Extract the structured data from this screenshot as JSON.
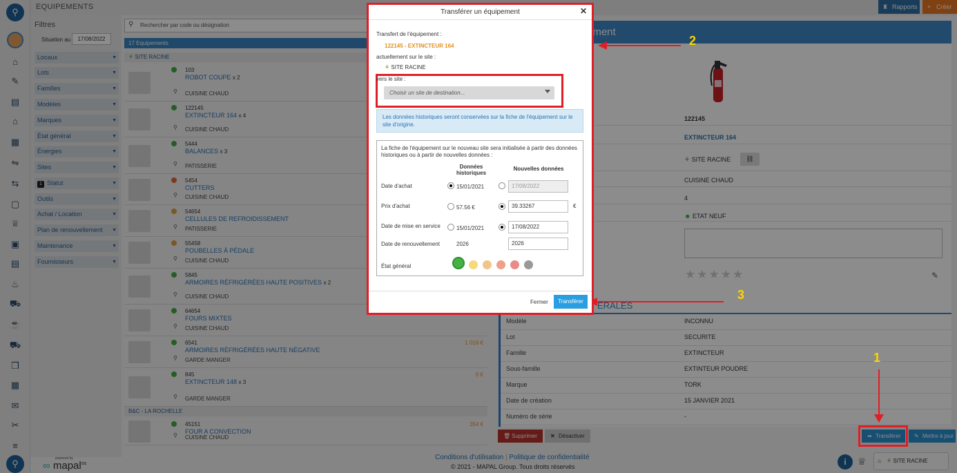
{
  "app": {
    "section_title": "EQUIPEMENTS",
    "reports_label": "Rapports",
    "create_label": "Créer"
  },
  "filters": {
    "title": "Filtres",
    "situation_label": "Situation au",
    "situation_date": "17/08/2022",
    "items": [
      "Locaux",
      "Lots",
      "Familles",
      "Modèles",
      "Marques",
      "État général",
      "Énergies",
      "Sites",
      "Statut",
      "Outils",
      "Achat / Location",
      "Plan de renouvellement",
      "Maintenance",
      "Fournisseurs"
    ],
    "status_badge": "1"
  },
  "list": {
    "search_placeholder": "Rechercher par code ou désignation",
    "count_label": "17 Equipements",
    "site1": "SITE RACINE",
    "site2": "B&C - LA ROCHELLE",
    "items": [
      {
        "code": "103",
        "name": "ROBOT COUPE",
        "qty": "x 2",
        "loc": "CUISINE CHAUD",
        "price": ""
      },
      {
        "code": "122145",
        "name": "EXTINCTEUR 164",
        "qty": "x 4",
        "loc": "CUISINE CHAUD",
        "price": ""
      },
      {
        "code": "5444",
        "name": "BALANCES",
        "qty": "x 3",
        "loc": "PATISSERIE",
        "price": ""
      },
      {
        "code": "5454",
        "name": "CUTTERS",
        "qty": "",
        "loc": "CUISINE CHAUD",
        "price": ""
      },
      {
        "code": "54654",
        "name": "CELLULES DE REFROIDISSEMENT",
        "qty": "",
        "loc": "PATISSERIE",
        "price": ""
      },
      {
        "code": "55458",
        "name": "POUBELLES À PÉDALE",
        "qty": "",
        "loc": "CUISINE CHAUD",
        "price": ""
      },
      {
        "code": "5845",
        "name": "ARMOIRES RÉFRIGÉRÉES HAUTE POSITIVES",
        "qty": "x 2",
        "loc": "CUISINE CHAUD",
        "price": ""
      },
      {
        "code": "64654",
        "name": "FOURS MIXTES",
        "qty": "",
        "loc": "CUISINE CHAUD",
        "price": ""
      },
      {
        "code": "6541",
        "name": "ARMOIRES RÉFRIGÉRÉES HAUTE NÉGATIVE",
        "qty": "",
        "loc": "GARDE MANGER",
        "price": "1 016 €"
      },
      {
        "code": "845",
        "name": "EXTINCTEUR 148",
        "qty": "x 3",
        "loc": "GARDE MANGER",
        "price": "0 €"
      },
      {
        "code": "45151",
        "name": "FOUR A CONVECTION",
        "qty": "",
        "loc": "CUISINE CHAUD",
        "price": "354 €"
      }
    ]
  },
  "detail": {
    "header": "ement",
    "code": "122145",
    "name": "EXTINCTEUR 164",
    "site": "SITE RACINE",
    "room": "CUISINE CHAUD",
    "qty": "4",
    "state": "ETAT NEUF",
    "section_title": "ÉRALES",
    "rows": [
      {
        "label": "Modèle",
        "value": "INCONNU"
      },
      {
        "label": "Lot",
        "value": "SECURITE"
      },
      {
        "label": "Famille",
        "value": "EXTINCTEUR"
      },
      {
        "label": "Sous-famille",
        "value": "EXTINTEUR POUDRE"
      },
      {
        "label": "Marque",
        "value": "TORK"
      },
      {
        "label": "Date de création",
        "value": "15 JANVIER 2021"
      },
      {
        "label": "Numéro de série",
        "value": "-"
      }
    ],
    "stars": "★★★★★",
    "delete_label": "Supprimer",
    "deactivate_label": "Désactiver",
    "transfer_label": "Transférer",
    "update_label": "Mettre à jour"
  },
  "modal": {
    "title": "Transférer un équipement",
    "transfer_of_label": "Transfert de l'équipement :",
    "equipment": "122145 - EXTINCTEUR 164",
    "current_site_label": "actuellement sur le site :",
    "current_site": "SITE RACINE",
    "to_site_label": "vers le site :",
    "dest_placeholder": "Choisir un site de destination...",
    "info": "Les données historiques seront conservées sur la fiche de l'équipement sur le site d'origine.",
    "init_text": "La fiche de l'équipement sur le nouveau site sera initialisée à partir des données historiques ou à partir de nouvelles données :",
    "col_hist": "Données historiques",
    "col_new": "Nouvelles données",
    "rows": [
      {
        "label": "Date d'achat",
        "hist": "15/01/2021",
        "new": "17/08/2022"
      },
      {
        "label": "Prix d'achat",
        "hist": "57.56 €",
        "new": "39.33267",
        "unit": "€"
      },
      {
        "label": "Date de mise en service",
        "hist": "15/01/2021",
        "new": "17/08/2022"
      },
      {
        "label": "Date de renouvellement",
        "hist": "2026",
        "new": "2026"
      }
    ],
    "state_label": "État général",
    "close_label": "Fermer",
    "submit_label": "Transférer"
  },
  "annotations": {
    "a1": "1",
    "a2": "2",
    "a3": "3"
  },
  "footer": {
    "terms": "Conditions d'utilisation",
    "sep": "|",
    "privacy": "Politique de confidentialité",
    "copyright": "© 2021 - MAPAL Group. Tous droits réservés",
    "powered": "powered by",
    "brand": "mapal",
    "brand_sup": "os",
    "site_label": "SITE RACINE"
  }
}
